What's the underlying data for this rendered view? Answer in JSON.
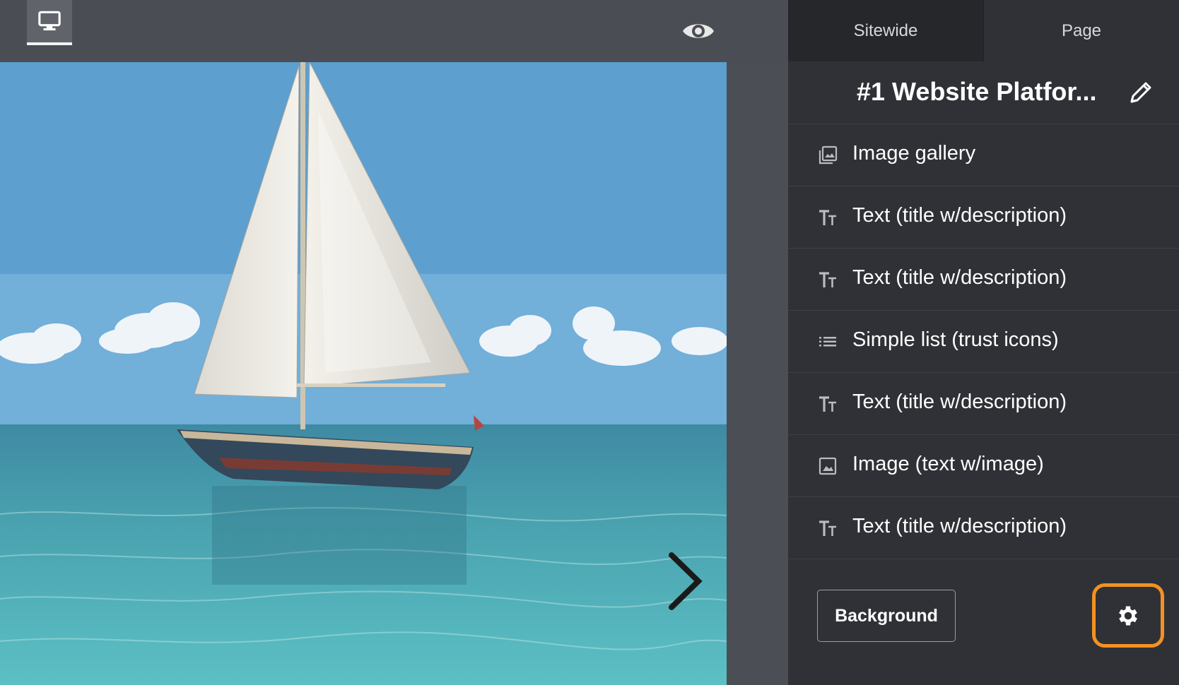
{
  "toolbar": {
    "device_icon": "desktop-monitor-icon",
    "preview_icon": "eye-icon"
  },
  "preview": {
    "image_subject": "sailboat-on-turquoise-sea",
    "next_icon": "chevron-right-icon"
  },
  "sidebar": {
    "tabs": [
      {
        "label": "Sitewide",
        "active": false
      },
      {
        "label": "Page",
        "active": true
      }
    ],
    "page_title": "#1 Website Platfor...",
    "edit_icon": "pencil-icon",
    "sections": [
      {
        "label": "Image gallery",
        "icon": "image-gallery-icon"
      },
      {
        "label": "Text (title w/description)",
        "icon": "text-size-icon"
      },
      {
        "label": "Text (title w/description)",
        "icon": "text-size-icon"
      },
      {
        "label": "Simple list (trust icons)",
        "icon": "list-icon"
      },
      {
        "label": "Text (title w/description)",
        "icon": "text-size-icon"
      },
      {
        "label": "Image (text w/image)",
        "icon": "image-icon"
      },
      {
        "label": "Text (title w/description)",
        "icon": "text-size-icon"
      }
    ],
    "background_button": "Background",
    "settings_icon": "gear-icon",
    "highlight_color": "#f39221"
  }
}
